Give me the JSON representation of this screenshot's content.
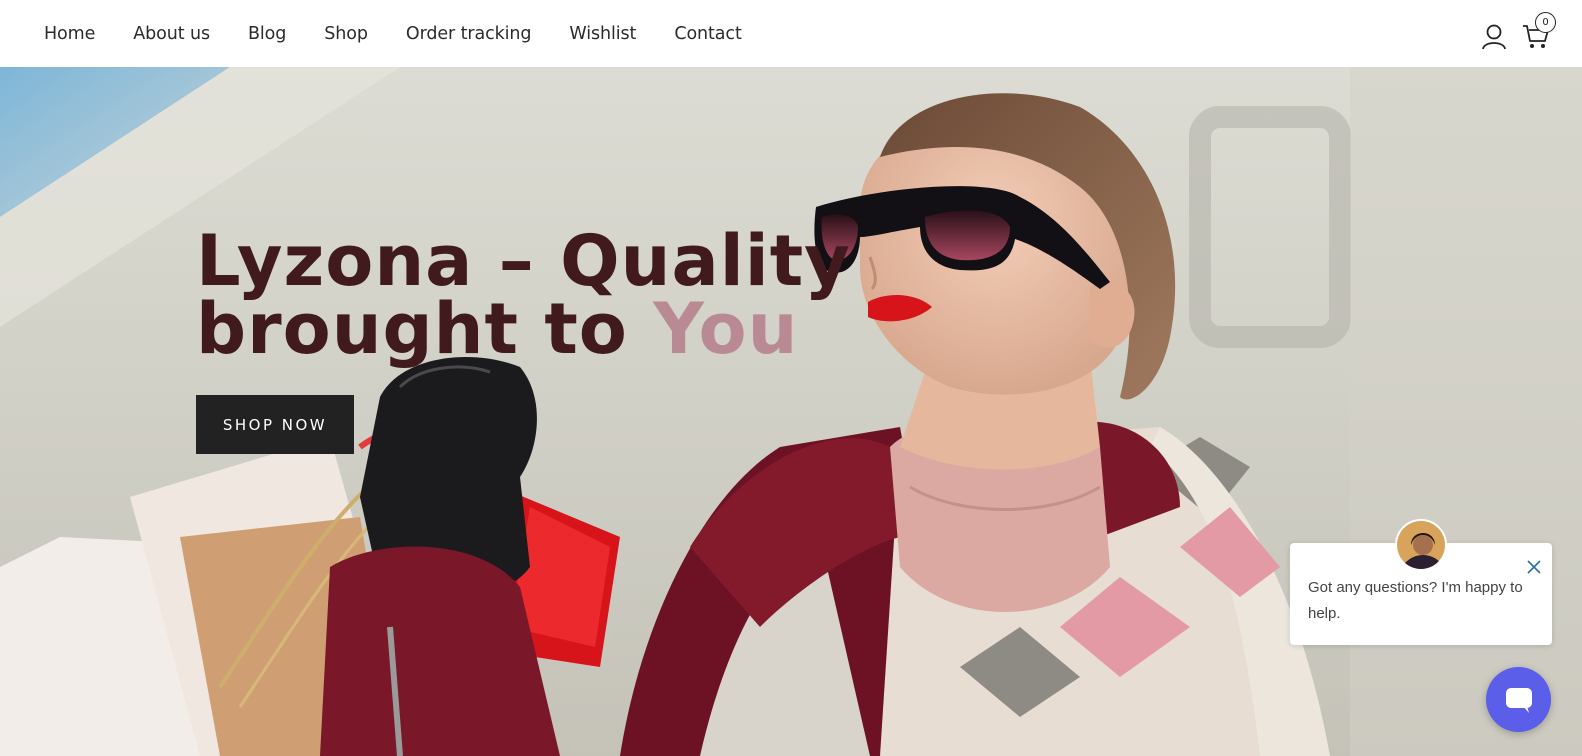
{
  "nav": {
    "items": [
      {
        "label": "Home"
      },
      {
        "label": "About us"
      },
      {
        "label": "Blog"
      },
      {
        "label": "Shop"
      },
      {
        "label": "Order tracking"
      },
      {
        "label": "Wishlist"
      },
      {
        "label": "Contact"
      }
    ]
  },
  "header": {
    "account_icon": "user-icon",
    "cart_icon": "cart-icon",
    "cart_count": "0"
  },
  "hero": {
    "headline_part1": "Lyzona – Quality",
    "headline_part2": "brought to ",
    "headline_accent": "You",
    "cta_label": "SHOP NOW",
    "colors": {
      "headline": "#401a1c",
      "accent": "#b98a93",
      "cta_bg": "#222222"
    }
  },
  "chat": {
    "message": "Got any questions? I'm happy to help.",
    "close_icon": "close-icon",
    "launcher_icon": "chat-icon",
    "launcher_color": "#5a5ee8"
  }
}
